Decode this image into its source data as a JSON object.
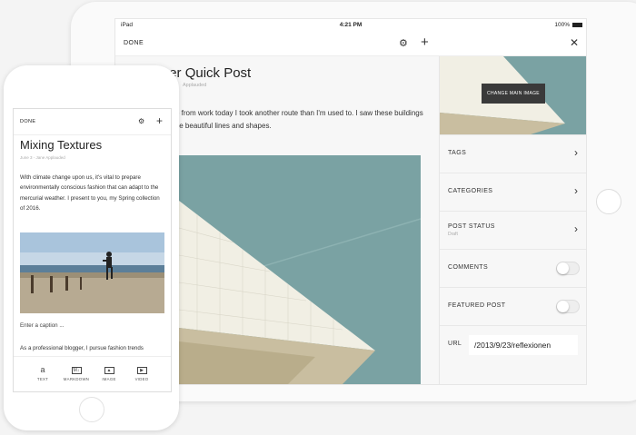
{
  "tablet": {
    "status": {
      "carrier": "iPad",
      "time": "4:21 PM",
      "battery": "100%"
    },
    "toolbar": {
      "done": "DONE"
    },
    "post": {
      "title": "Another Quick Post",
      "meta": "Applauded",
      "body": "Walking home from work today I took another route than I'm used to. I saw these buildings and noticed the beautiful lines and shapes."
    },
    "panel": {
      "change_image": "CHANGE MAIN IMAGE",
      "rows": [
        {
          "label": "TAGS"
        },
        {
          "label": "CATEGORIES"
        },
        {
          "label": "POST STATUS",
          "sub": "Draft"
        },
        {
          "label": "COMMENTS",
          "toggle": false
        },
        {
          "label": "FEATURED POST",
          "toggle": false
        },
        {
          "label": "URL"
        }
      ],
      "url_value": "/2013/9/23/reflexionen"
    },
    "colors": {
      "sky": "#7aa2a3",
      "building": "#f1efe4",
      "building_shadow": "#c9bea0"
    }
  },
  "phone": {
    "toolbar": {
      "done": "DONE"
    },
    "post": {
      "title": "Mixing Textures",
      "meta": "June 3 - Jane Applauded",
      "body": "With climate change upon us, it's vital to prepare environmentally conscious fashion that can adapt to the mercurial weather. I present to you, my Spring collection of 2016.",
      "caption": "Enter a caption ...",
      "more": "As a professional blogger, I pursue fashion trends"
    },
    "blocks": [
      {
        "label": "TEXT",
        "icon": "text-icon"
      },
      {
        "label": "MARKDOWN",
        "icon": "markdown-icon"
      },
      {
        "label": "IMAGE",
        "icon": "image-icon"
      },
      {
        "label": "VIDEO",
        "icon": "video-icon"
      }
    ]
  }
}
